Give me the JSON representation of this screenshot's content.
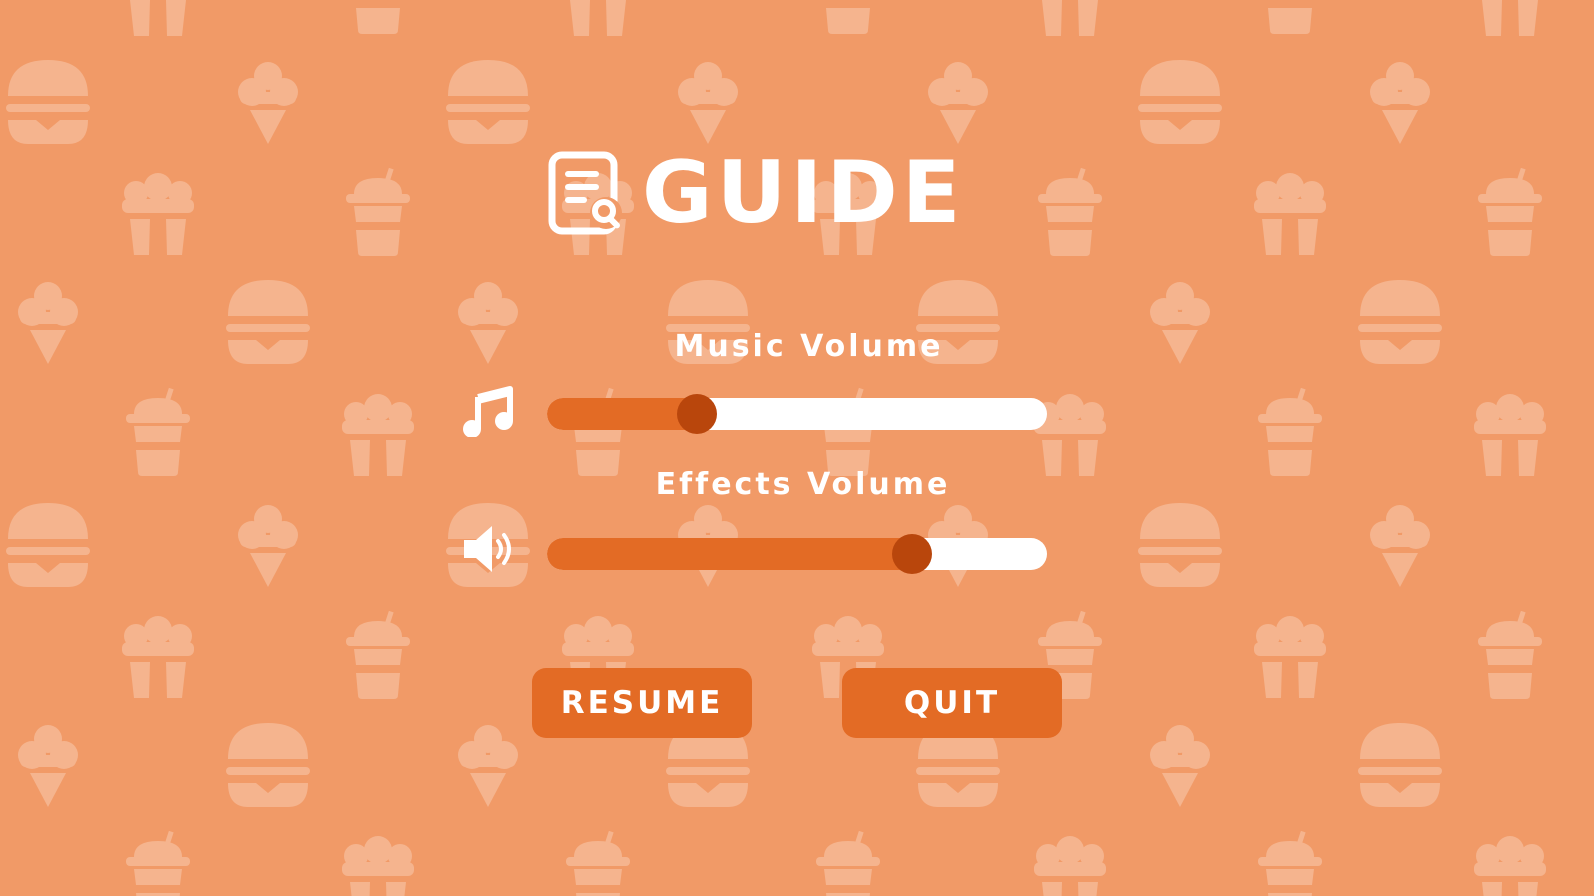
{
  "screen": {
    "background_color": "#f19a67",
    "pattern_color": "#f5b48e",
    "pattern_icons": [
      "burger-icon",
      "ice-cream-icon",
      "popcorn-icon",
      "drink-cup-icon"
    ]
  },
  "header": {
    "icon": "guide-document-search-icon",
    "title": "GUIDE"
  },
  "music": {
    "label": "Music Volume",
    "icon": "music-note-icon",
    "level": 0.3
  },
  "effects": {
    "label": "Effects Volume",
    "icon": "speaker-icon",
    "level": 0.73
  },
  "buttons": {
    "resume": "RESUME",
    "quit": "QUIT"
  },
  "colors": {
    "accent": "#e36b25",
    "knob": "#b9460c",
    "track": "#ffffff",
    "text": "#ffffff"
  }
}
